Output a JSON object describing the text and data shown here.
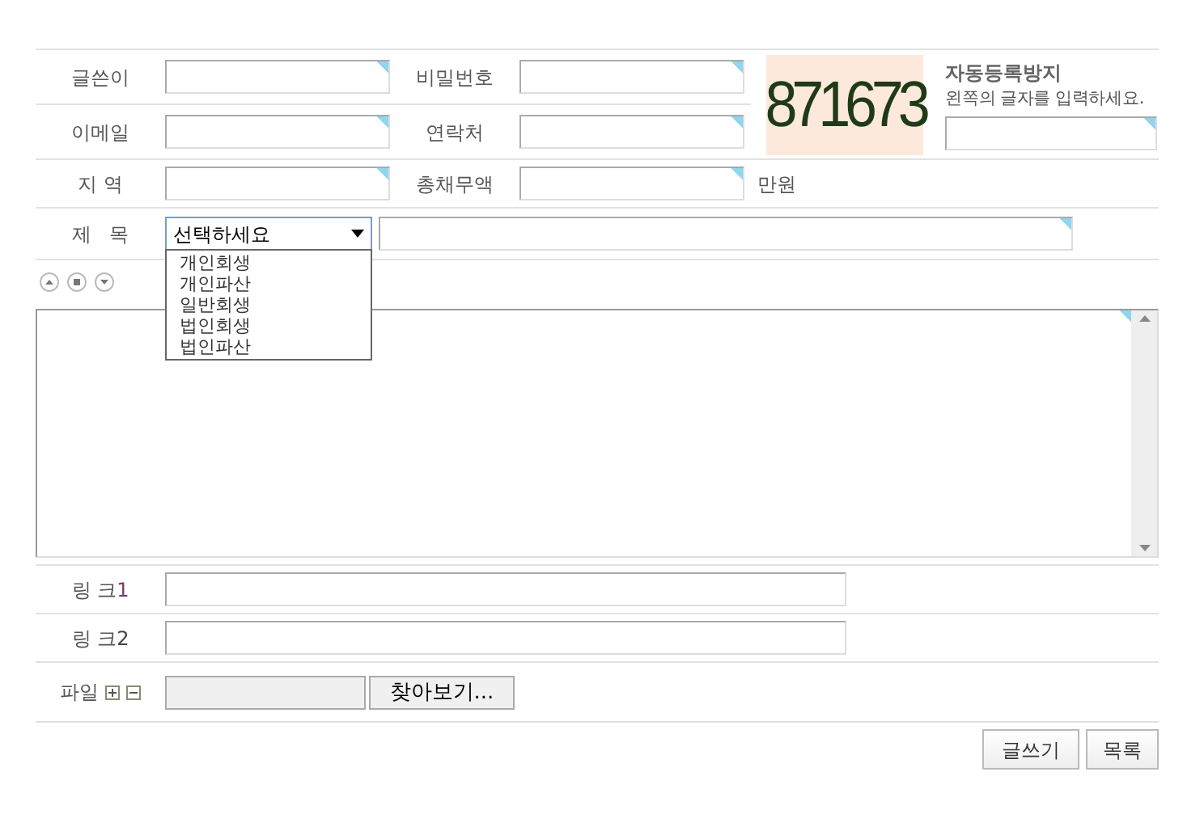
{
  "fields": [
    {
      "label": "글쓴이"
    },
    {
      "label": "비밀번호"
    },
    {
      "label": "이메일"
    },
    {
      "label": "연락처"
    },
    {
      "label": "지 역"
    },
    {
      "label": "총채무액",
      "suffix": "만원"
    }
  ],
  "captcha": {
    "code": "871673",
    "title": "자동등록방지",
    "hint": "왼쪽의 글자를 입력하세요."
  },
  "subject": {
    "label": "제   목",
    "select": {
      "value": "선택하세요",
      "expanded": true,
      "options": [
        "개인회생",
        "개인파산",
        "일반회생",
        "법인회생",
        "법인파산"
      ]
    }
  },
  "links": [
    {
      "label": "링 크",
      "number": "1"
    },
    {
      "label": "링 크",
      "number": "2"
    }
  ],
  "file": {
    "label": "파일",
    "button": "찾아보기..."
  },
  "buttons": [
    "글쓰기",
    "목록"
  ]
}
